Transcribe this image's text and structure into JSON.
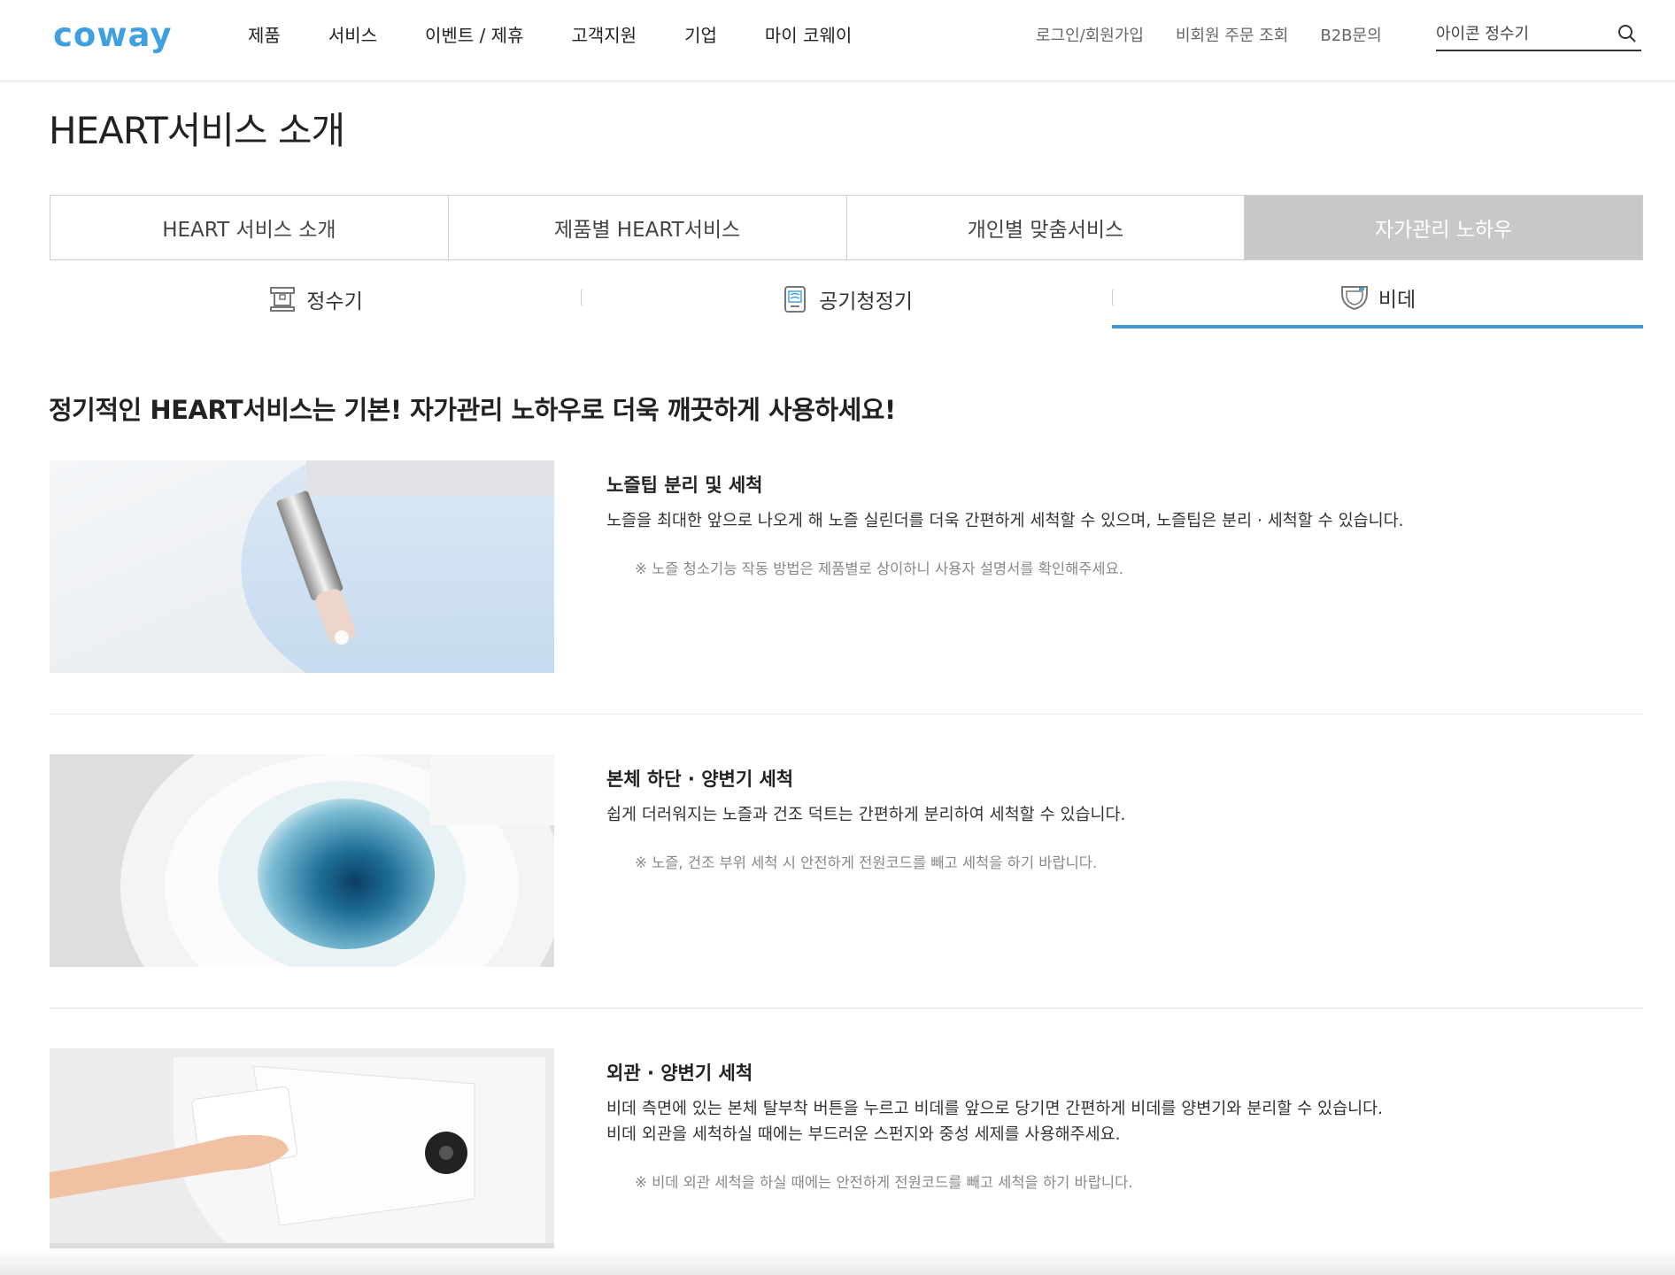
{
  "header": {
    "logo": "coway",
    "nav": [
      "제품",
      "서비스",
      "이벤트 / 제휴",
      "고객지원",
      "기업",
      "마이 코웨이"
    ],
    "util": [
      "로그인/회원가입",
      "비회원 주문 조회",
      "B2B문의"
    ],
    "search_placeholder": "아이콘 정수기",
    "search_icon": "search-icon"
  },
  "page": {
    "title": "HEART서비스 소개"
  },
  "tabs": [
    {
      "label": "HEART 서비스 소개",
      "active": false
    },
    {
      "label": "제품별 HEART서비스",
      "active": false
    },
    {
      "label": "개인별 맞춤서비스",
      "active": false
    },
    {
      "label": "자가관리 노하우",
      "active": true
    }
  ],
  "subtabs": [
    {
      "label": "정수기",
      "icon": "water-purifier-icon",
      "active": false
    },
    {
      "label": "공기청정기",
      "icon": "air-purifier-icon",
      "active": false
    },
    {
      "label": "비데",
      "icon": "bidet-icon",
      "active": true
    }
  ],
  "lead": "정기적인 HEART서비스는 기본! 자가관리 노하우로 더욱 깨끗하게 사용하세요!",
  "items": [
    {
      "title": "노즐팁 분리 및 세척",
      "desc1": "노즐을 최대한 앞으로 나오게 해 노즐 실린더를 더욱 간편하게 세척할 수 있으며, 노즐팁은 분리 · 세척할 수 있습니다.",
      "desc2": "",
      "note": "※ 노즐 청소기능 작동 방법은 제품별로 상이하니 사용자 설명서를 확인해주세요."
    },
    {
      "title": "본체 하단 · 양변기 세척",
      "desc1": "쉽게 더러워지는 노즐과 건조 덕트는 간편하게 분리하여 세척할 수 있습니다.",
      "desc2": "",
      "note": "※ 노즐, 건조 부위 세척 시 안전하게 전원코드를 빼고 세척을 하기 바랍니다."
    },
    {
      "title": "외관 · 양변기 세척",
      "desc1": "비데 측면에 있는 본체 탈부착 버튼을 누르고 비데를 앞으로 당기면 간편하게 비데를 양변기와 분리할 수 있습니다.",
      "desc2": "비데 외관을 세척하실 때에는 부드러운 스펀지와 중성 세제를 사용해주세요.",
      "note": "※ 비데 외관 세척을 하실 때에는 안전하게 전원코드를 빼고 세척을 하기 바랍니다."
    }
  ],
  "colors": {
    "brand": "#3fa0e0",
    "active_tab_bg": "#c8c8c8",
    "subtab_underline": "#3f95d8"
  }
}
